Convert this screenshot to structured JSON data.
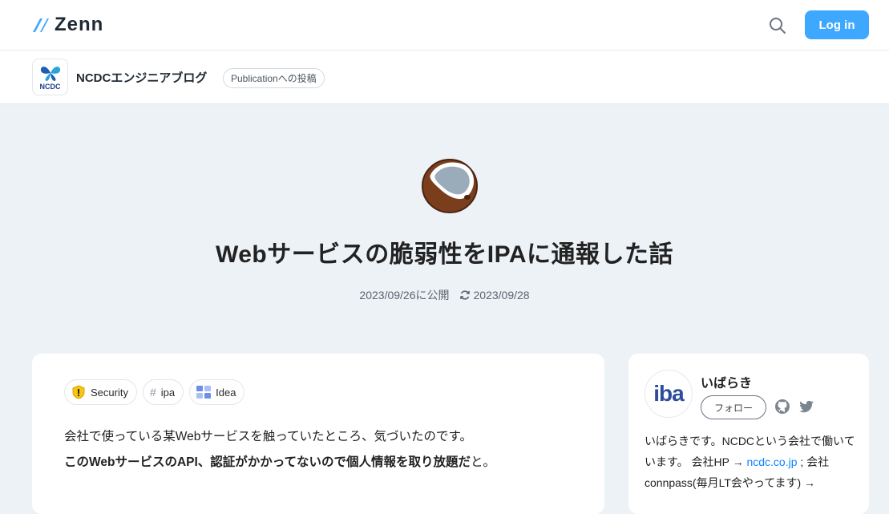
{
  "header": {
    "logo_text": "Zenn",
    "login_label": "Log in"
  },
  "publication": {
    "logo_text": "NCDC",
    "name": "NCDCエンジニアブログ",
    "badge": "Publicationへの投稿"
  },
  "article": {
    "title": "Webサービスの脆弱性をIPAに通報した話",
    "published": "2023/09/26に公開",
    "updated": "2023/09/28",
    "tags": [
      {
        "label": "Security",
        "icon": "shield-icon"
      },
      {
        "label": "ipa",
        "icon": "hash-icon"
      },
      {
        "label": "Idea",
        "icon": "idea-icon"
      }
    ],
    "hash_symbol": "#",
    "paragraph1": "会社で使っている某Webサービスを触っていたところ、気づいたのです。",
    "paragraph2_bold": "このWebサービスのAPI、認証がかかってないので個人情報を取り放題だ",
    "paragraph2_tail": "と。"
  },
  "author": {
    "avatar_text": "iba",
    "name": "いばらき",
    "follow_label": "フォロー",
    "bio_1": "いばらきです。NCDCという会社で働いています。 会社HP → ",
    "bio_link": "ncdc.co.jp",
    "bio_2": " ; 会社connpass(毎月LT会やってます) → "
  },
  "colors": {
    "accent": "#3ea8ff",
    "background": "#edf2f7",
    "link": "#0f83fd"
  }
}
